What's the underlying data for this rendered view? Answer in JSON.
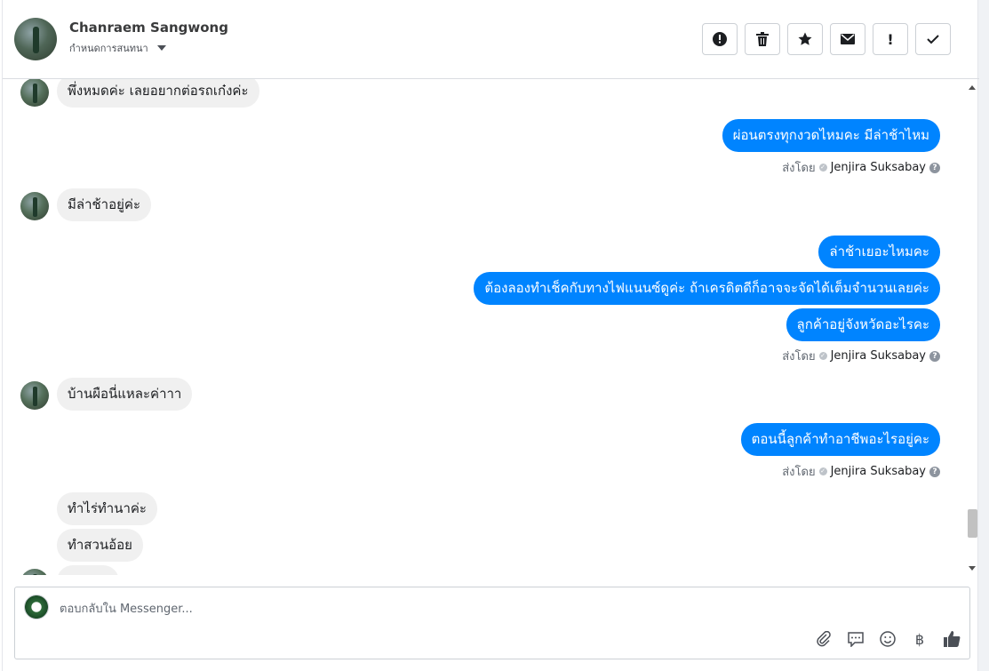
{
  "header": {
    "name": "Chanraem Sangwong",
    "subtitle": "กำหนดการสนทนา",
    "actions": [
      {
        "icon": "exclamation-circle-icon",
        "glyph": "!"
      },
      {
        "icon": "trash-icon",
        "glyph": "🗑"
      },
      {
        "icon": "star-icon",
        "glyph": "★"
      },
      {
        "icon": "envelope-icon",
        "glyph": "✉"
      },
      {
        "icon": "exclamation-icon",
        "glyph": "!"
      },
      {
        "icon": "checkmark-icon",
        "glyph": "✓"
      }
    ]
  },
  "messages": [
    {
      "dir": "in",
      "text": "พึ่งหมดค่ะ เลยอยากต่อรถเก๋งค่ะ"
    },
    {
      "dir": "out",
      "text": "ผ่อนตรงทุกงวดไหมคะ มีล่าช้าไหม"
    },
    {
      "dir": "in",
      "text": "มีล่าช้าอยู่ค่ะ"
    },
    {
      "dir": "out",
      "text": "ล่าช้าเยอะไหมคะ"
    },
    {
      "dir": "out",
      "text": "ต้องลองทำเช็คกับทางไฟแนนซ์ดูค่ะ ถ้าเครดิตดีก็อาจจะจัดได้เต็มจำนวนเลยค่ะ"
    },
    {
      "dir": "out",
      "text": "ลูกค้าอยู่จังหวัดอะไรคะ"
    },
    {
      "dir": "in",
      "text": "บ้านผือนี่แหละค่าาา"
    },
    {
      "dir": "out",
      "text": "ตอนนี้ลูกค้าทำอาชีพอะไรอยู่คะ"
    },
    {
      "dir": "in",
      "text": "ทำไร่ทำนาค่ะ"
    },
    {
      "dir": "in",
      "text": "ทำสวนอ้อย"
    }
  ],
  "sent_by": {
    "prefix": "ส่งโดย",
    "sender": "Jenjira Suksabay"
  },
  "composer": {
    "placeholder": "ตอบกลับใน Messenger...",
    "icons": [
      {
        "icon": "paperclip-icon",
        "glyph": "📎"
      },
      {
        "icon": "quick-reply-icon",
        "glyph": "💬"
      },
      {
        "icon": "emoji-icon",
        "glyph": "☺"
      },
      {
        "icon": "baht-icon",
        "glyph": "฿"
      },
      {
        "icon": "thumbs-up-icon",
        "glyph": "👍"
      }
    ]
  },
  "colors": {
    "outgoing_bubble": "#0084ff",
    "incoming_bubble": "#f0f0f0",
    "accent": "#0084ff"
  }
}
